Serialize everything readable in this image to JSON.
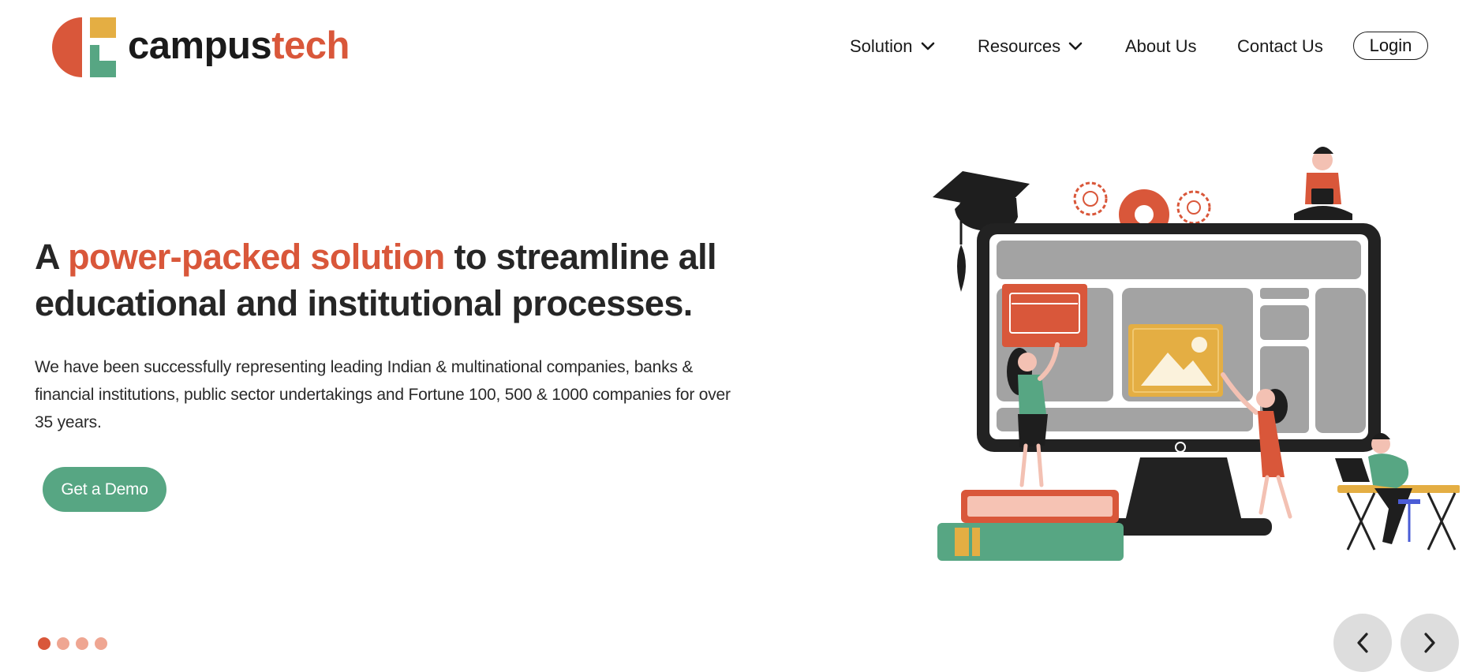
{
  "brand": {
    "name_part1": "campus",
    "name_part2": "tech",
    "colors": {
      "orange": "#d9573a",
      "green": "#57a683",
      "yellow": "#e4ae43",
      "dark": "#1a1a1a"
    }
  },
  "nav": {
    "items": [
      {
        "label": "Solution",
        "has_dropdown": true
      },
      {
        "label": "Resources",
        "has_dropdown": true
      },
      {
        "label": "About Us",
        "has_dropdown": false
      },
      {
        "label": "Contact Us",
        "has_dropdown": false
      }
    ],
    "login_label": "Login"
  },
  "hero": {
    "title_prefix": "A ",
    "title_accent": "power-packed solution",
    "title_suffix": " to streamline all educational and institutional processes.",
    "description": "We have been successfully representing leading Indian & multinational companies, banks & financial institutions, public sector undertakings and Fortune 100, 500 & 1000 companies for over 35 years.",
    "cta_label": "Get a Demo"
  },
  "carousel": {
    "slide_count": 4,
    "active_index": 0,
    "prev_icon": "chevron-left-icon",
    "next_icon": "chevron-right-icon"
  }
}
